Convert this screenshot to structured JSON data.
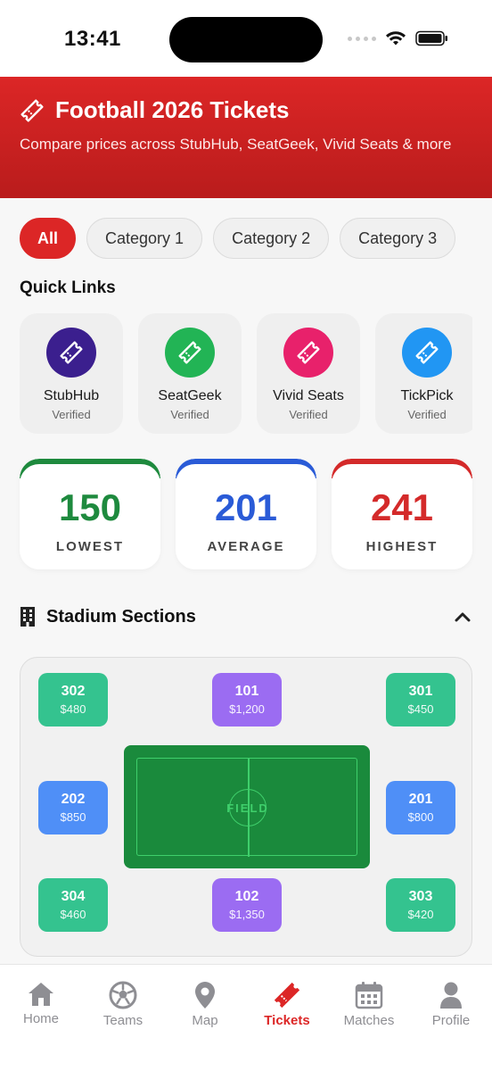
{
  "status": {
    "time": "13:41"
  },
  "header": {
    "title": "Football 2026 Tickets",
    "subtitle": "Compare prices across StubHub, SeatGeek, Vivid Seats & more",
    "icon": "ticket-icon"
  },
  "filters": [
    {
      "label": "All",
      "active": true
    },
    {
      "label": "Category 1",
      "active": false
    },
    {
      "label": "Category 2",
      "active": false
    },
    {
      "label": "Category 3",
      "active": false
    }
  ],
  "quick_links": {
    "title": "Quick Links",
    "items": [
      {
        "name": "StubHub",
        "status": "Verified",
        "color": "#3b1f8e"
      },
      {
        "name": "SeatGeek",
        "status": "Verified",
        "color": "#22b455"
      },
      {
        "name": "Vivid Seats",
        "status": "Verified",
        "color": "#e8216b"
      },
      {
        "name": "TickPick",
        "status": "Verified",
        "color": "#2196f3"
      }
    ]
  },
  "price_stats": [
    {
      "value": "150",
      "label": "LOWEST",
      "color": "#1e8a3e"
    },
    {
      "value": "201",
      "label": "AVERAGE",
      "color": "#2a5bd7"
    },
    {
      "value": "241",
      "label": "HIGHEST",
      "color": "#d42a2a"
    }
  ],
  "stadium": {
    "title": "Stadium Sections",
    "field_label": "FIELD",
    "sections": [
      {
        "number": "302",
        "price": "$480",
        "color": "#34c38f"
      },
      {
        "number": "101",
        "price": "$1,200",
        "color": "#9b6cf2"
      },
      {
        "number": "301",
        "price": "$450",
        "color": "#34c38f"
      },
      {
        "number": "202",
        "price": "$850",
        "color": "#4f8ff7"
      },
      {
        "number": "201",
        "price": "$800",
        "color": "#4f8ff7"
      },
      {
        "number": "304",
        "price": "$460",
        "color": "#34c38f"
      },
      {
        "number": "102",
        "price": "$1,350",
        "color": "#9b6cf2"
      },
      {
        "number": "303",
        "price": "$420",
        "color": "#34c38f"
      }
    ]
  },
  "tabbar": {
    "items": [
      {
        "label": "Home",
        "icon": "home-icon"
      },
      {
        "label": "Teams",
        "icon": "soccer-ball-icon"
      },
      {
        "label": "Map",
        "icon": "map-pin-icon"
      },
      {
        "label": "Tickets",
        "icon": "ticket-icon",
        "active": true
      },
      {
        "label": "Matches",
        "icon": "calendar-icon"
      },
      {
        "label": "Profile",
        "icon": "person-icon"
      }
    ]
  },
  "colors": {
    "accent": "#dc2626",
    "inactive_tab": "#8e8e93"
  }
}
